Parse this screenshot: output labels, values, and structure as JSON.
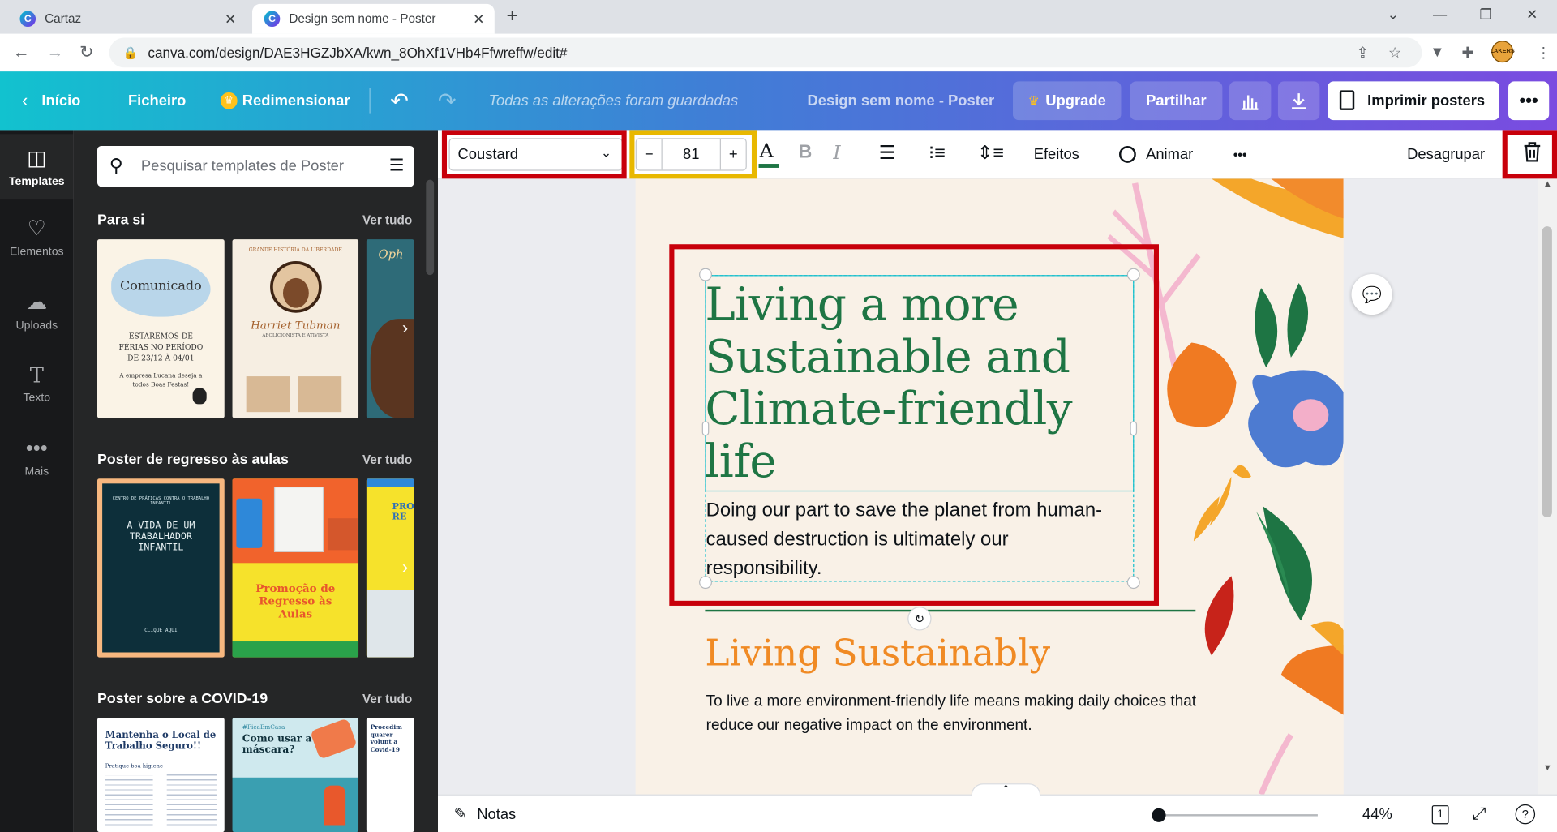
{
  "browser": {
    "tabs": [
      {
        "title": "Cartaz",
        "favicon": "C"
      },
      {
        "title": "Design sem nome - Poster",
        "favicon": "C"
      }
    ],
    "url": "canva.com/design/DAE3HGZJbXA/kwn_8OhXf1VHb4Ffwreffw/edit#"
  },
  "header": {
    "home": "Início",
    "file": "Ficheiro",
    "resize": "Redimensionar",
    "saved_status": "Todas as alterações foram guardadas",
    "doc_title": "Design sem nome - Poster",
    "upgrade": "Upgrade",
    "share": "Partilhar",
    "print": "Imprimir posters",
    "more": "•••"
  },
  "rail": {
    "items": [
      {
        "label": "Templates",
        "icon": "templates-icon"
      },
      {
        "label": "Elementos",
        "icon": "elements-icon"
      },
      {
        "label": "Uploads",
        "icon": "upload-cloud-icon"
      },
      {
        "label": "Texto",
        "icon": "text-icon"
      },
      {
        "label": "Mais",
        "icon": "more-dots-icon"
      }
    ]
  },
  "panel": {
    "search_placeholder": "Pesquisar templates de Poster",
    "see_all": "Ver tudo",
    "sections": [
      {
        "title": "Para si"
      },
      {
        "title": "Poster de regresso às aulas"
      },
      {
        "title": "Poster sobre a COVID-19"
      }
    ],
    "thumbs": {
      "t1_title": "Comunicado",
      "t1_body": "ESTAREMOS DE FÉRIAS NO PERÍODO DE 23/12 À 04/01",
      "t1_foot": "A empresa Lucana deseja a todos Boas Festas!",
      "t2_top": "GRANDE HISTÓRIA DA LIBERDADE",
      "t2_name": "Harriet Tubman",
      "t2_sub": "ABOLICIONISTA E ATIVISTA",
      "t3_text": "Oph",
      "t4_title": "A VIDA DE UM TRABALHADOR INFANTIL",
      "t4_top": "CENTRO DE PRÁTICAS CONTRA O TRABALHO INFANTIL",
      "t4_foot": "CLIQUE AQUI",
      "t5_title": "Promoção de Regresso às Aulas",
      "t6_title": "PRO RE",
      "t7_title": "Mantenha o Local de Trabalho Seguro!!",
      "t7_sub": "Pratique boa higiene",
      "t8_tag": "#FicaEmCasa",
      "t8_title": "Como usar a máscara?",
      "t9_title": "Procedim quarer volunt a Covid-19"
    }
  },
  "toolbar": {
    "font": "Coustard",
    "font_size": "81",
    "minus": "−",
    "plus": "+",
    "effects": "Efeitos",
    "animate": "Animar",
    "more": "•••",
    "ungroup": "Desagrupar"
  },
  "poster": {
    "headline": "Living a more Sustainable and Climate-friendly life",
    "body": "Doing our part to save the planet from human-caused destruction is ultimately our responsibility.",
    "subhead": "Living Sustainably",
    "paragraph": "To live a more environment-friendly life means making daily choices that reduce our negative impact on the environment."
  },
  "footer": {
    "notes": "Notas",
    "zoom": "44%",
    "page_count": "1",
    "help": "?",
    "zoom_level": 0.02
  },
  "colors": {
    "highlight_red": "#c8000b",
    "highlight_yellow": "#e8b800",
    "headline_green": "#1e7544",
    "subhead_orange": "#f08a24",
    "selection_cyan": "#18bfcd"
  }
}
